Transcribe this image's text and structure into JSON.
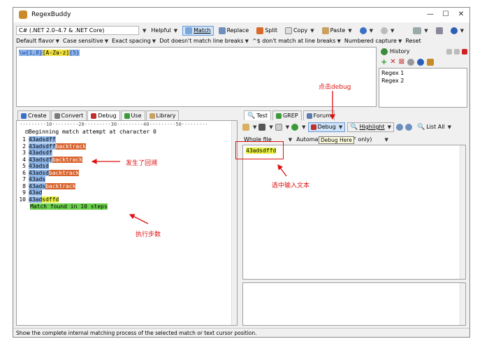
{
  "window": {
    "title": "RegexBuddy"
  },
  "toolbar1": {
    "flavor": "C# (.NET 2.0–4.7 & .NET Core)",
    "helpful": "Helpful",
    "match": "Match",
    "replace": "Replace",
    "split": "Split",
    "copy": "Copy",
    "paste": "Paste"
  },
  "toolbar2": {
    "default_flavor": "Default flavor",
    "case": "Case sensitive",
    "spacing": "Exact spacing",
    "dot": "Dot doesn't match line breaks",
    "anchors": "^$ don't match at line breaks",
    "capture": "Numbered capture",
    "reset": "Reset"
  },
  "regex": {
    "part1": "\\w{1,8}",
    "part2": "[A-Za-z]",
    "part3": "{5}"
  },
  "history": {
    "title": "History",
    "items": [
      "Regex 1",
      "Regex 2"
    ]
  },
  "left_tabs": [
    "Create",
    "Convert",
    "Debug",
    "Use",
    "Library"
  ],
  "debug": {
    "ruler": "·········10·········20·········30·········40·········50·········",
    "header": "⊟Beginning match attempt at character 0",
    "lines": [
      {
        "n": "1",
        "m": "43adsdff",
        "t": "",
        "tc": ""
      },
      {
        "n": "2",
        "m": "43adsdff",
        "t": "backtrack",
        "tc": "bt"
      },
      {
        "n": "3",
        "m": "43adsdf",
        "t": "",
        "tc": ""
      },
      {
        "n": "4",
        "m": "43adsdf",
        "t": "backtrack",
        "tc": "bt"
      },
      {
        "n": "5",
        "m": "43adsd",
        "t": "",
        "tc": ""
      },
      {
        "n": "6",
        "m": "43adsd",
        "t": "backtrack",
        "tc": "bt"
      },
      {
        "n": "7",
        "m": "43ads",
        "t": "",
        "tc": ""
      },
      {
        "n": "8",
        "m": "43ads",
        "t": "backtrack",
        "tc": "bt"
      },
      {
        "n": "9",
        "m": "43ad",
        "t": "",
        "tc": ""
      },
      {
        "n": "10",
        "m": "43ad",
        "t": "sdffd",
        "tc": "ok"
      }
    ],
    "found": "Match found in 10 steps"
  },
  "right_tabs": [
    "Test",
    "GREP",
    "Forum"
  ],
  "test_toolbar": {
    "debug": "Debug",
    "highlight": "Highlight",
    "list_all": "List All",
    "tooltip": "Debug Here"
  },
  "test": {
    "scope": "Whole file",
    "mode": "Automati",
    "lineend": "LF only)",
    "text": "43adsdffd"
  },
  "annotations": {
    "debug": "点击debug",
    "backtrack": "发生了回溯",
    "select": "选中输入文本",
    "steps": "执行步数"
  },
  "status": "Show the complete internal matching process of the selected match or text cursor position.",
  "colors": {
    "accent": "#8fb6e8",
    "backtrack": "#d8622a",
    "found": "#6ad04a",
    "annotation": "#e01010"
  }
}
